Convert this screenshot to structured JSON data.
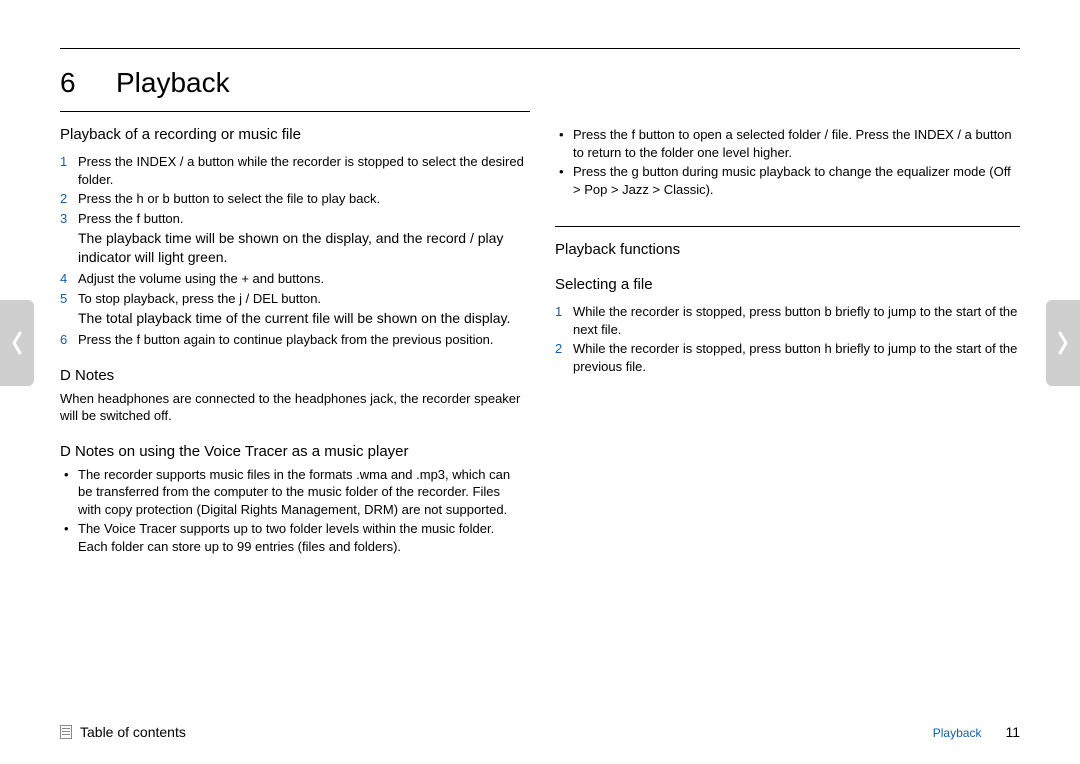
{
  "chapter": {
    "number": "6",
    "title": "Playback"
  },
  "left": {
    "section_title": "Playback of a recording or music file",
    "steps": [
      "Press the INDEX / a button while the recorder is stopped to select the desired folder.",
      "Press the h   or b   button to select the file to play back.",
      "Press the f   button."
    ],
    "result1": "The playback time will be shown on the display, and the record / play indicator will light green.",
    "steps2": [
      "Adjust the volume using the + and   buttons.",
      "To stop playback, press the j / DEL button."
    ],
    "result2": "The total playback time of the current file will be shown on the display.",
    "steps3": [
      "Press the f   button again to continue playback from the previous position."
    ],
    "notes_title": "D   Notes",
    "notes_text": "When headphones are connected to the headphones jack, the recorder speaker will be switched off.",
    "music_notes_title": "D   Notes on using the Voice Tracer as a music player",
    "music_notes": [
      "The recorder supports music files in the formats .wma and .mp3, which can be transferred from the computer to the music folder of the recorder. Files with copy protection (Digital Rights Management, DRM) are not supported.",
      "The Voice Tracer supports up to two folder levels within the music folder. Each folder can store up to 99 entries (files and folders)."
    ]
  },
  "right": {
    "cont_bullets": [
      "Press the f   button to open a selected folder / file. Press the INDEX / a button to return to the folder one level higher.",
      "Press the g   button during music playback to change the equalizer mode (Off > Pop > Jazz > Classic)."
    ],
    "functions_title": "Playback functions",
    "selecting_title": "Selecting a file",
    "selecting_steps": [
      "While the recorder is stopped, press button b   briefly to jump to the start of the next file.",
      "While the recorder is stopped, press button h   briefly to jump to the start of the previous file."
    ]
  },
  "footer": {
    "toc": "Table of contents",
    "crumb": "Playback",
    "page": "11"
  }
}
